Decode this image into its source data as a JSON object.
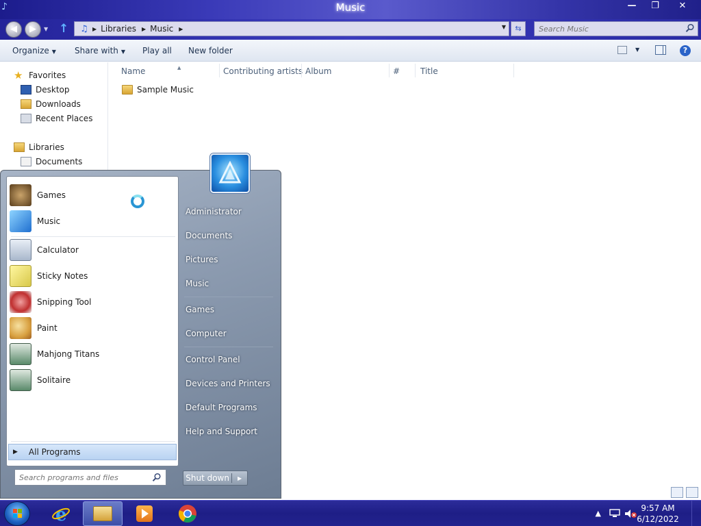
{
  "window": {
    "title": "Music",
    "address": {
      "crumbs": [
        "Libraries",
        "Music"
      ]
    },
    "search_placeholder": "Search Music",
    "toolbar": {
      "organize": "Organize",
      "share_with": "Share with",
      "play_all": "Play all",
      "new_folder": "New folder"
    },
    "nav": {
      "favorites": "Favorites",
      "desktop": "Desktop",
      "downloads": "Downloads",
      "recent_places": "Recent Places",
      "libraries": "Libraries",
      "documents": "Documents"
    },
    "columns": [
      "Name",
      "Contributing artists",
      "Album",
      "#",
      "Title"
    ],
    "files": [
      {
        "name": "Sample Music",
        "icon": "folder-icon"
      }
    ]
  },
  "start_menu": {
    "programs": [
      {
        "label": "Games",
        "icon": "games-icon"
      },
      {
        "label": "Music",
        "icon": "music-icon"
      },
      {
        "label": "Calculator",
        "icon": "calculator-icon"
      },
      {
        "label": "Sticky Notes",
        "icon": "sticky-notes-icon"
      },
      {
        "label": "Snipping Tool",
        "icon": "snipping-tool-icon"
      },
      {
        "label": "Paint",
        "icon": "paint-icon"
      },
      {
        "label": "Mahjong Titans",
        "icon": "mahjong-titans-icon"
      },
      {
        "label": "Solitaire",
        "icon": "solitaire-icon"
      }
    ],
    "all_programs": "All Programs",
    "search_placeholder": "Search programs and files",
    "right_items": [
      "Administrator",
      "Documents",
      "Pictures",
      "Music",
      "Games",
      "Computer",
      "Control Panel",
      "Devices and Printers",
      "Default Programs",
      "Help and Support"
    ],
    "shutdown": "Shut down"
  },
  "taskbar": {
    "time": "9:57 AM",
    "date": "6/12/2022"
  },
  "colors": {
    "titlebar": "#2e2eae",
    "taskbar": "#1e1e86",
    "start_menu_right": "#8c9bb0",
    "accent": "#2a63c8"
  }
}
